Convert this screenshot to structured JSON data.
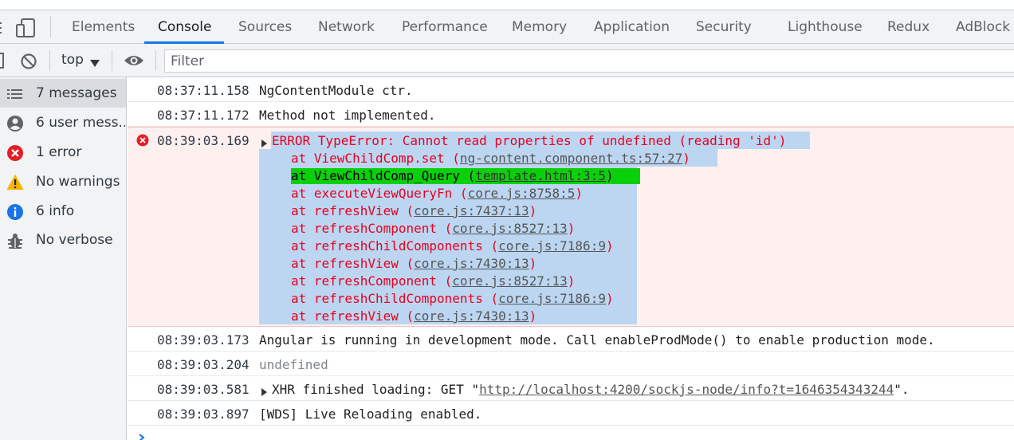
{
  "tabs": [
    "Elements",
    "Console",
    "Sources",
    "Network",
    "Performance",
    "Memory",
    "Application",
    "Security",
    "Lighthouse",
    "Redux",
    "AdBlock"
  ],
  "active_tab": "Console",
  "toolbar": {
    "context": "top",
    "filter_placeholder": "Filter"
  },
  "sidebar": [
    {
      "label": "7 messages",
      "icon": "list-icon"
    },
    {
      "label": "6 user mess...",
      "icon": "user-icon"
    },
    {
      "label": "1 error",
      "icon": "error-icon"
    },
    {
      "label": "No warnings",
      "icon": "warning-icon"
    },
    {
      "label": "6 info",
      "icon": "info-icon"
    },
    {
      "label": "No verbose",
      "icon": "bug-icon"
    }
  ],
  "messages": [
    {
      "ts": "08:37:11.158",
      "text": "NgContentModule ctr."
    },
    {
      "ts": "08:37:11.172",
      "text": "Method not implemented."
    },
    {
      "ts": "08:39:03.169",
      "error_head": "ERROR TypeError: Cannot read properties of undefined (reading 'id')"
    },
    {
      "ts": "08:39:03.173",
      "text": "Angular is running in development mode. Call enableProdMode() to enable production mode."
    },
    {
      "ts": "08:39:03.204",
      "text": "undefined"
    },
    {
      "ts": "08:39:03.581",
      "xhr_prefix": "XHR finished loading: GET \"",
      "xhr_url": "http://localhost:4200/sockjs-node/info?t=1646354343244",
      "xhr_suffix": "\"."
    },
    {
      "ts": "08:39:03.897",
      "text": "[WDS] Live Reloading enabled."
    }
  ],
  "stack": [
    {
      "fn": "at ViewChildComp.set (",
      "loc": "ng-content.component.ts:57:27",
      "end": ")"
    },
    {
      "fn": "at ViewChildComp_Query (",
      "loc": "template.html:3:5",
      "end": ")"
    },
    {
      "fn": "at executeViewQueryFn (",
      "loc": "core.js:8758:5",
      "end": ")"
    },
    {
      "fn": "at refreshView (",
      "loc": "core.js:7437:13",
      "end": ")"
    },
    {
      "fn": "at refreshComponent (",
      "loc": "core.js:8527:13",
      "end": ")"
    },
    {
      "fn": "at refreshChildComponents (",
      "loc": "core.js:7186:9",
      "end": ")"
    },
    {
      "fn": "at refreshView (",
      "loc": "core.js:7430:13",
      "end": ")"
    },
    {
      "fn": "at refreshComponent (",
      "loc": "core.js:8527:13",
      "end": ")"
    },
    {
      "fn": "at refreshChildComponents (",
      "loc": "core.js:7186:9",
      "end": ")"
    },
    {
      "fn": "at refreshView (",
      "loc": "core.js:7430:13",
      "end": ")"
    }
  ],
  "colors": {
    "error_text": "#e8001f",
    "error_bg": "#fff0f0",
    "selection": "#bcd6f2",
    "highlight": "#0ad00a",
    "accent": "#1a73e8"
  }
}
